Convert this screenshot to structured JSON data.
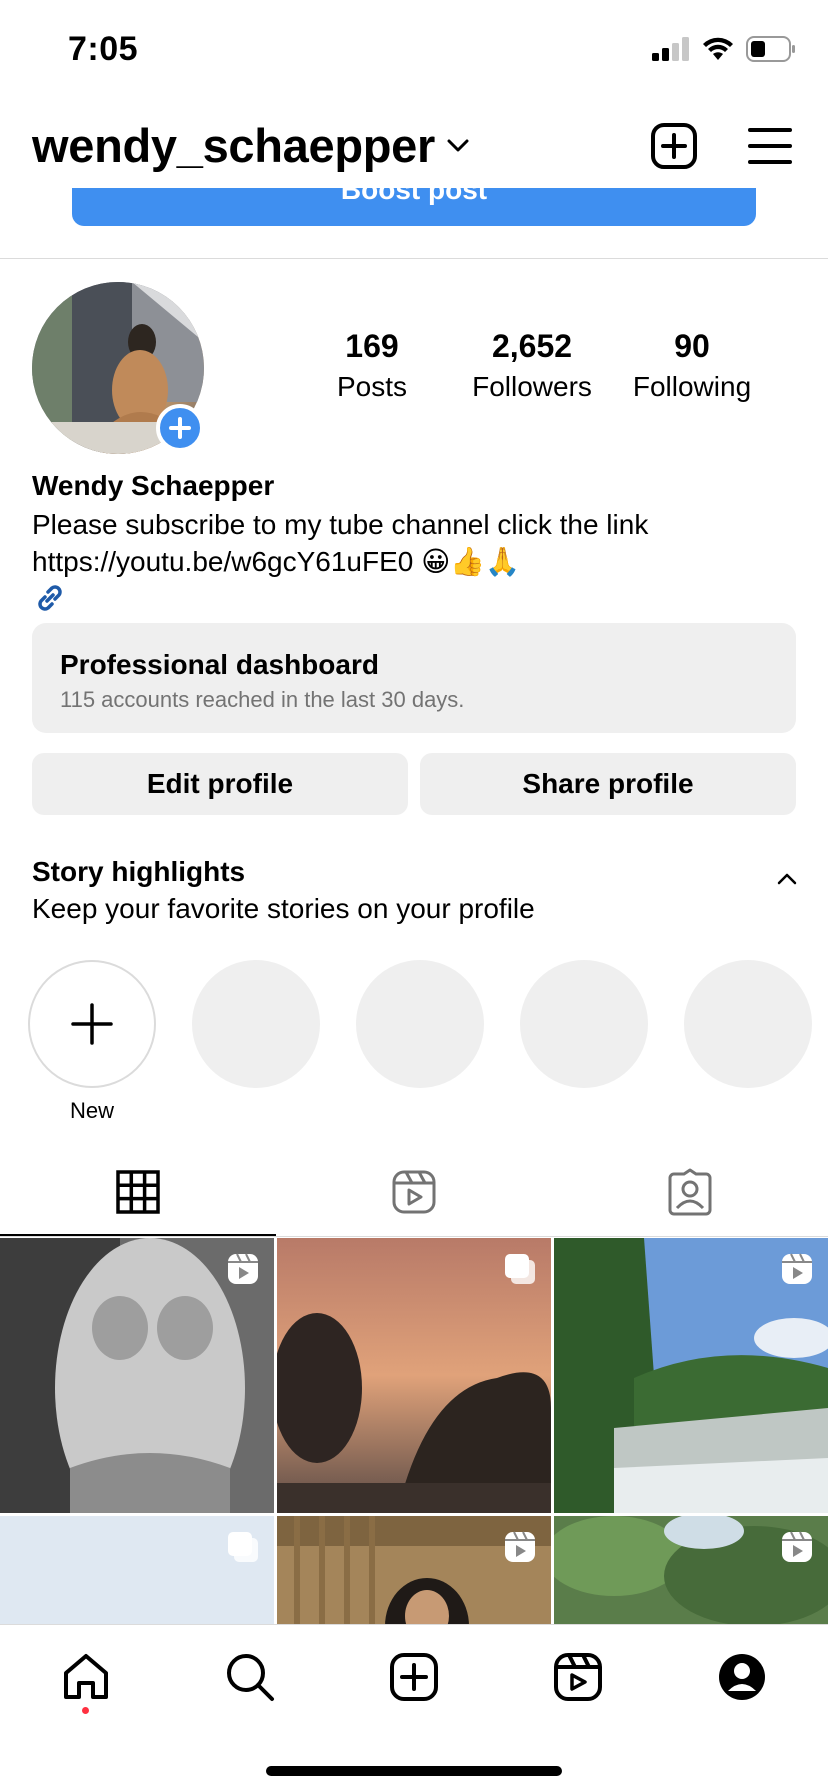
{
  "status_bar": {
    "time": "7:05"
  },
  "header": {
    "username": "wendy_schaepper",
    "boost_label": "Boost post"
  },
  "profile": {
    "stats": [
      {
        "value": "169",
        "label": "Posts"
      },
      {
        "value": "2,652",
        "label": "Followers"
      },
      {
        "value": "90",
        "label": "Following"
      }
    ],
    "full_name": "Wendy Schaepper",
    "bio": "Please subscribe to my tube channel click the link https://youtu.be/w6gcY61uFE0 😀👍🙏"
  },
  "dashboard": {
    "title": "Professional dashboard",
    "subtitle": "115 accounts reached in the last 30 days."
  },
  "actions": {
    "edit_profile": "Edit profile",
    "share_profile": "Share profile"
  },
  "highlights": {
    "title": "Story highlights",
    "subtitle": "Keep your favorite stories on your profile",
    "new_label": "New"
  },
  "tabs": [
    {
      "icon": "grid-icon",
      "active": true
    },
    {
      "icon": "reels-icon",
      "active": false
    },
    {
      "icon": "tagged-icon",
      "active": false
    }
  ],
  "grid_posts": [
    {
      "type": "reel",
      "scene": "monochrome"
    },
    {
      "type": "carousel",
      "scene": "sunset"
    },
    {
      "type": "reel",
      "scene": "waterfall"
    },
    {
      "type": "carousel",
      "scene": "sky"
    },
    {
      "type": "reel",
      "scene": "bamboo-hut"
    },
    {
      "type": "reel",
      "scene": "trees"
    }
  ],
  "bottom_nav": [
    {
      "icon": "home-icon",
      "active": true
    },
    {
      "icon": "search-icon"
    },
    {
      "icon": "create-icon"
    },
    {
      "icon": "reels-icon"
    },
    {
      "icon": "profile-icon"
    }
  ],
  "colors": {
    "accent": "#3f8ff0",
    "notification": "#ff3040",
    "surface": "#efefef"
  }
}
